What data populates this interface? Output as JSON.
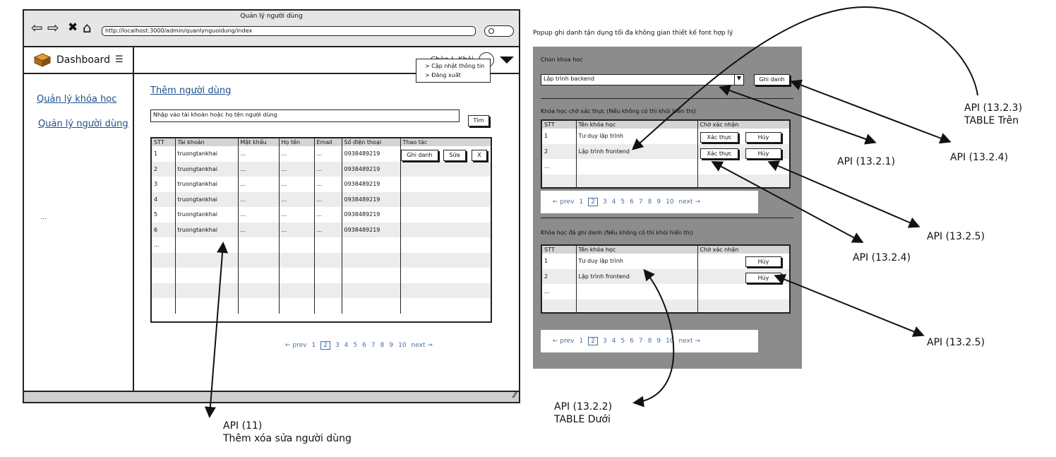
{
  "browser": {
    "window_title": "Quản lý người dùng",
    "url": "http://localhost:3000/admin/quanlynguoidung/index"
  },
  "sidebar": {
    "brand": "Dashboard",
    "items": [
      {
        "label": "Quản lý khóa học"
      },
      {
        "label": "Quản lý người dùng"
      }
    ],
    "more": "..."
  },
  "topbar": {
    "greeting": "Chào !, Khải",
    "menu": [
      "> Cập nhật thông tin",
      "> Đăng xuất"
    ]
  },
  "main": {
    "title": "Thêm người dùng",
    "search_placeholder": "Nhập vào tài khoản hoặc họ tên người dùng",
    "search_button": "Tìm",
    "table": {
      "headers": [
        "STT",
        "Tài khoản",
        "Mật khẩu",
        "Họ tên",
        "Email",
        "Số điện thoại",
        "Thao tác"
      ],
      "rows": [
        [
          "1",
          "truongtankhai",
          "...",
          "...",
          "...",
          "0938489219"
        ],
        [
          "2",
          "truongtankhai",
          "...",
          "...",
          "...",
          "0938489219"
        ],
        [
          "3",
          "truongtankhai",
          "...",
          "...",
          "...",
          "0938489219"
        ],
        [
          "4",
          "truongtankhai",
          "...",
          "...",
          "...",
          "0938489219"
        ],
        [
          "5",
          "truongtankhai",
          "...",
          "...",
          "...",
          "0938489219"
        ],
        [
          "6",
          "truongtankhai",
          "...",
          "...",
          "...",
          "0938489219"
        ],
        [
          "...",
          "",
          "",
          "",
          "",
          ""
        ]
      ],
      "actions": {
        "enroll": "Ghi danh",
        "edit": "Sửa",
        "delete": "X"
      }
    },
    "pagination": {
      "prev": "← prev",
      "pages": [
        "1",
        "2",
        "3",
        "4",
        "5",
        "6",
        "7",
        "8",
        "9",
        "10"
      ],
      "current": "2",
      "next": "next →"
    }
  },
  "popup": {
    "note": "Popup ghi danh tận dụng tối đa không gian thiết kế font hợp lý",
    "choose_label": "Chon khoa hoc",
    "selected_course": "Lập trình backend",
    "enroll_button": "Ghi danh",
    "pending": {
      "heading": "Khóa học chờ xác thực (Nếu không có thì khỏi hiển thị)",
      "headers": [
        "STT",
        "Tên khóa học",
        "Chờ xác nhận"
      ],
      "rows": [
        {
          "stt": "1",
          "name": "Tư duy lập trình"
        },
        {
          "stt": "2",
          "name": "Lập trình frontend"
        },
        {
          "stt": "...",
          "name": ""
        }
      ],
      "confirm_label": "Xác thực",
      "cancel_label": "Hủy"
    },
    "enrolled": {
      "heading": "Khóa học đã ghi danh (Nếu không có thì khỏi hiển thị)",
      "headers": [
        "STT",
        "Tên khóa học",
        "Chờ xác nhận"
      ],
      "rows": [
        {
          "stt": "1",
          "name": "Tư duy lập trình"
        },
        {
          "stt": "2",
          "name": "Lập trình frontend"
        },
        {
          "stt": "...",
          "name": ""
        }
      ],
      "cancel_label": "Hủy"
    },
    "pagination": {
      "prev": "← prev",
      "pages": [
        "1",
        "2",
        "3",
        "4",
        "5",
        "6",
        "7",
        "8",
        "9",
        "10"
      ],
      "current": "2",
      "next": "next →"
    }
  },
  "annotations": {
    "api_11": "API (11)",
    "api_11_desc": "Thêm xóa sửa người dùng",
    "api_1321": "API (13.2.1)",
    "api_1322": "API (13.2.2)",
    "api_1322_desc": "TABLE Dưới",
    "api_1323": "API (13.2.3)",
    "api_1323_desc": "TABLE Trên",
    "api_1324_a": "API (13.2.4)",
    "api_1324_b": "API (13.2.4)",
    "api_1325_a": "API (13.2.5)",
    "api_1325_b": "API (13.2.5)"
  }
}
